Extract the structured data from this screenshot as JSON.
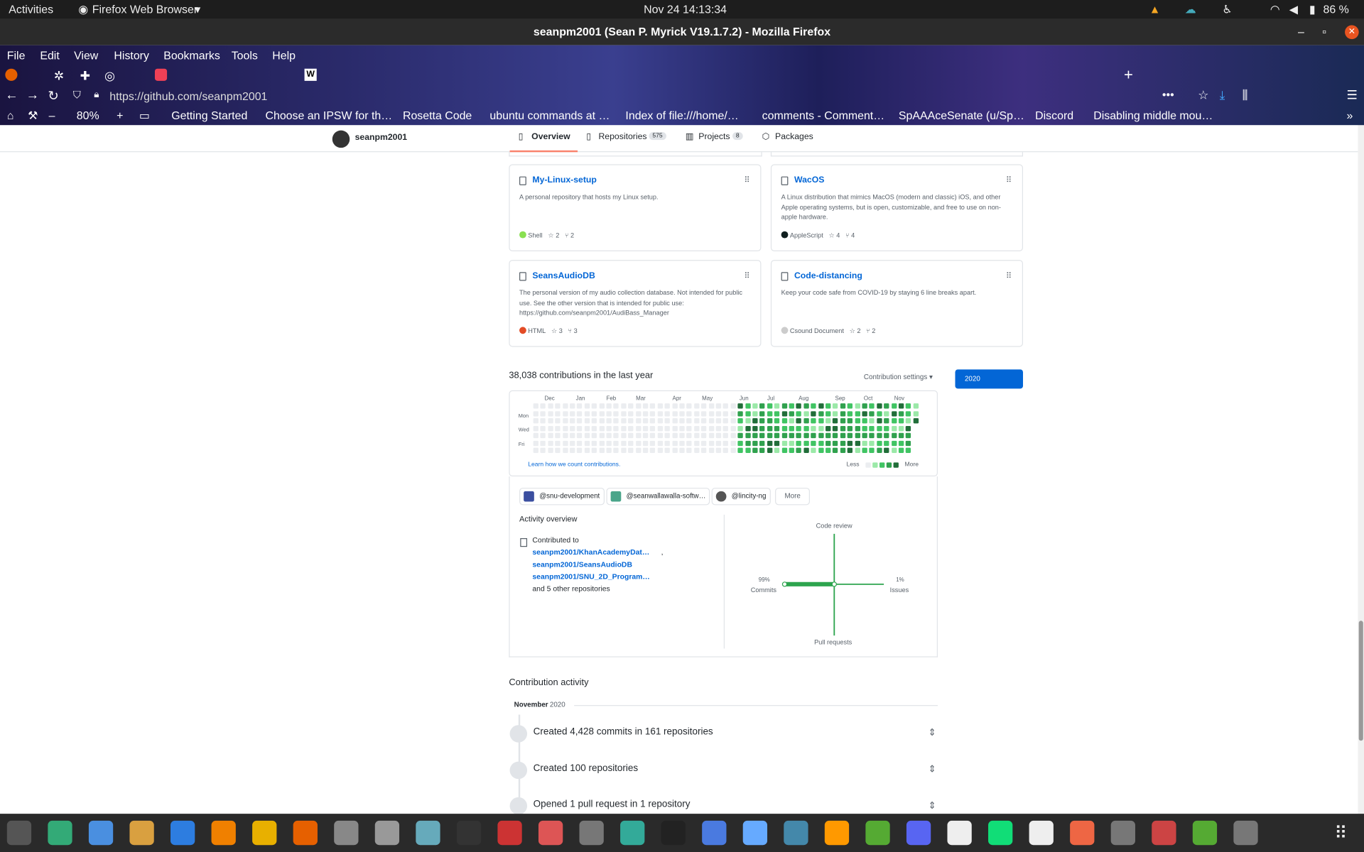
{
  "topbar": {
    "activities": "Activities",
    "app": "Firefox Web Browser",
    "clock": "Nov 24  14:13:34",
    "battery": "86 %"
  },
  "window": {
    "title": "seanpm2001 (Sean P. Myrick V19.1.7.2) - Mozilla Firefox"
  },
  "menu": [
    "File",
    "Edit",
    "View",
    "History",
    "Bookmarks",
    "Tools",
    "Help"
  ],
  "urlbar": {
    "url": "https://github.com/seanpm2001"
  },
  "zoom": "80%",
  "bookmarks": [
    "Getting Started",
    "Choose an IPSW for th…",
    "Rosetta Code",
    "ubuntu commands at …",
    "Index of file:///home/…",
    "comments - Comment…",
    "SpAAAceSenate (u/Sp…",
    "Discord",
    "Disabling middle mou…"
  ],
  "profile": {
    "username": "seanpm2001"
  },
  "tabs": [
    {
      "label": "Overview",
      "count": ""
    },
    {
      "label": "Repositories",
      "count": "575"
    },
    {
      "label": "Projects",
      "count": "8"
    },
    {
      "label": "Packages",
      "count": ""
    }
  ],
  "repos": [
    {
      "name": "My-Linux-setup",
      "desc": "A personal repository that hosts my Linux setup.",
      "lang": "Shell",
      "color": "#89e051",
      "stars": "2",
      "forks": "2"
    },
    {
      "name": "WacOS",
      "desc": "A Linux distribution that mimics MacOS (modern and classic) iOS, and other Apple operating systems, but is open, customizable, and free to use on non-apple hardware.",
      "lang": "AppleScript",
      "color": "#101f1f",
      "stars": "4",
      "forks": "4"
    },
    {
      "name": "SeansAudioDB",
      "desc": "The personal version of my audio collection database. Not intended for public use. See the other version that is intended for public use: https://github.com/seanpm2001/AudiBass_Manager",
      "lang": "HTML",
      "color": "#e34c26",
      "stars": "3",
      "forks": "3"
    },
    {
      "name": "Code-distancing",
      "desc": "Keep your code safe from COVID-19 by staying 6 line breaks apart.",
      "lang": "Csound Document",
      "color": "#cccccc",
      "stars": "2",
      "forks": "2"
    }
  ],
  "contrib": {
    "heading": "38,038 contributions in the last year",
    "settings": "Contribution settings ▾",
    "year": "2020",
    "months": [
      "Dec",
      "Jan",
      "Feb",
      "Mar",
      "Apr",
      "May",
      "Jun",
      "Jul",
      "Aug",
      "Sep",
      "Oct",
      "Nov"
    ],
    "days": [
      "Mon",
      "Wed",
      "Fri"
    ],
    "learn": "Learn how we count contributions.",
    "less": "Less",
    "more": "More"
  },
  "orgs": [
    "@snu-development",
    "@seanwallawalla-softw…",
    "@lincity-ng"
  ],
  "orgs_more": "More",
  "overview": {
    "title": "Activity overview",
    "contributed": "Contributed to",
    "repos": [
      "seanpm2001/KhanAcademyDat…",
      "seanpm2001/SeansAudioDB",
      "seanpm2001/SNU_2D_Program…"
    ],
    "other": "and 5 other repositories",
    "code_review": "Code review",
    "commits_pct": "99%",
    "commits": "Commits",
    "issues_pct": "1%",
    "issues": "Issues",
    "pull_requests": "Pull requests"
  },
  "activity": {
    "title": "Contribution activity",
    "month": "November",
    "year": "2020",
    "items": [
      "Created 4,428 commits in 161 repositories",
      "Created 100 repositories",
      "Opened 1 pull request in 1 repository"
    ]
  },
  "colors": {
    "link": "#0366d6",
    "green1": "#9be9a8",
    "green2": "#40c463",
    "green3": "#30a14e",
    "green4": "#216e39",
    "empty": "#ebedf0",
    "primary": "#0366d6"
  }
}
